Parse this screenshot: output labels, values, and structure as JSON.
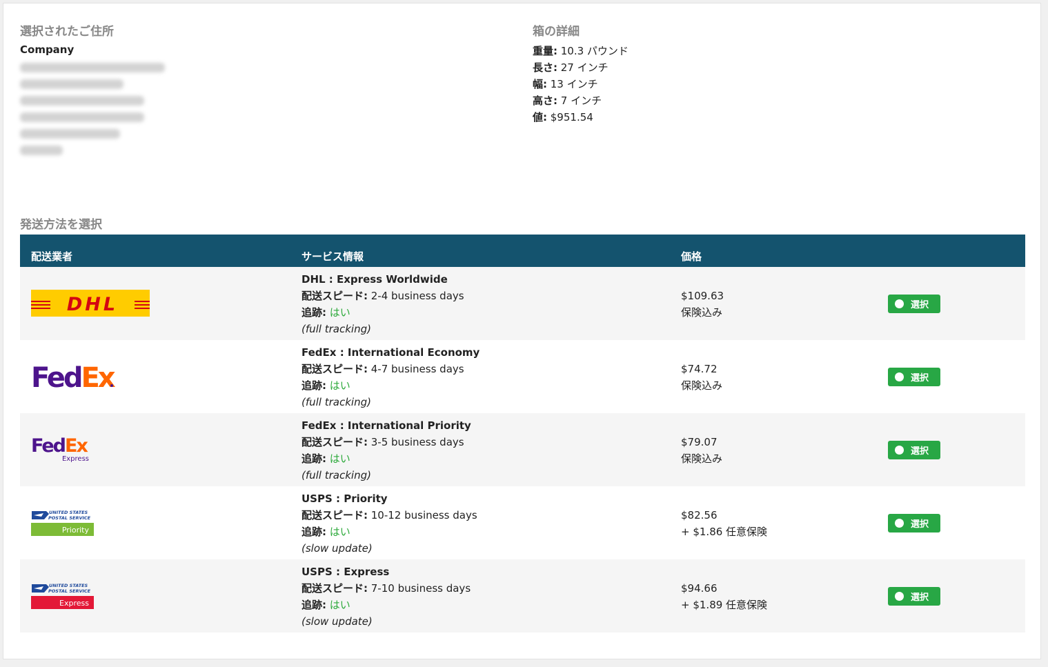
{
  "address": {
    "title": "選択されたご住所",
    "company": "Company"
  },
  "box": {
    "title": "箱の詳細",
    "lines": [
      {
        "label": "重量:",
        "value": " 10.3 パウンド"
      },
      {
        "label": "長さ:",
        "value": " 27 インチ"
      },
      {
        "label": "幅:",
        "value": " 13 インチ"
      },
      {
        "label": "高さ:",
        "value": " 7 インチ"
      },
      {
        "label": "値:",
        "value": " $951.54"
      }
    ]
  },
  "shipping": {
    "title": "発送方法を選択",
    "headers": {
      "carrier": "配送業者",
      "service": "サービス情報",
      "price": "価格"
    },
    "speed_label": "配送スピード:",
    "tracking_label": "追跡:",
    "select_label": "選択",
    "rows": [
      {
        "logo": "DHL",
        "service": "DHL : Express Worldwide",
        "speed": " 2-4 business days",
        "tracking": "はい",
        "note": "(full tracking)",
        "price": "$109.63",
        "insurance": "保険込み"
      },
      {
        "logo": "FedEx",
        "service": "FedEx : International Economy",
        "speed": " 4-7 business days",
        "tracking": "はい",
        "note": "(full tracking)",
        "price": "$74.72",
        "insurance": "保険込み"
      },
      {
        "logo": "FedEx Express",
        "service": "FedEx : International Priority",
        "speed": " 3-5 business days",
        "tracking": "はい",
        "note": "(full tracking)",
        "price": "$79.07",
        "insurance": "保険込み"
      },
      {
        "logo": "USPS Priority",
        "service": "USPS : Priority",
        "speed": " 10-12 business days",
        "tracking": "はい",
        "note": "(slow update)",
        "price": "$82.56",
        "insurance": "+ $1.86 任意保険"
      },
      {
        "logo": "USPS Express",
        "service": "USPS : Express",
        "speed": " 7-10 business days",
        "tracking": "はい",
        "note": "(slow update)",
        "price": "$94.66",
        "insurance": "+ $1.89 任意保険"
      }
    ]
  },
  "logos": {
    "dhl": "DHL",
    "fedex_a": "Fed",
    "fedex_b": "Ex",
    "fedex_express": "Express",
    "usps_line1": "UNITED STATES",
    "usps_line2": "POSTAL SERVICE",
    "usps_priority": "Priority",
    "usps_express": "Express"
  },
  "colors": {
    "header_bg": "#14536e",
    "select_button": "#28a745",
    "tracking_yes": "#2eaa3c",
    "dhl_yellow": "#ffcc00",
    "dhl_red": "#d40511",
    "fedex_purple": "#4d148c",
    "fedex_orange": "#ff6600",
    "usps_blue": "#1f4a9c",
    "usps_green": "#7dbb36",
    "usps_red": "#e31837"
  }
}
